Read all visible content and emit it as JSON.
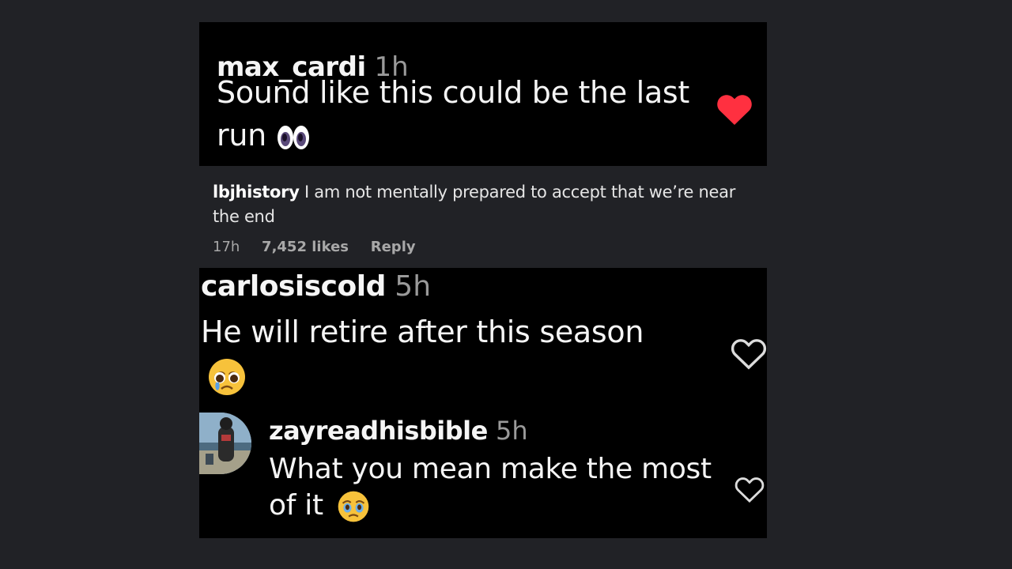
{
  "comment1": {
    "username": "max_cardi",
    "time": "1h",
    "text": "Sound like this could be the last run",
    "emoji": "eyes-emoji",
    "liked": true
  },
  "comment2": {
    "username": "lbjhistory",
    "text": "I am not mentally prepared to accept that we’re near the end",
    "time": "17h",
    "likes": "7,452 likes",
    "reply_label": "Reply"
  },
  "comment3": {
    "username": "carlosiscold",
    "time": "5h",
    "text": "He will retire after this season",
    "emoji": "pleading-face-emoji",
    "liked": false
  },
  "reply": {
    "username": "zayreadhisbible",
    "time": "5h",
    "text": "What you mean make the most of it",
    "emoji": "face-holding-back-tears-emoji",
    "liked": false
  },
  "colors": {
    "background": "#212226",
    "card": "#000000",
    "heart_active": "#ff3040",
    "timestamp": "#9a9a9a"
  },
  "icons": [
    "heart-filled-icon",
    "heart-outline-icon",
    "avatar"
  ]
}
